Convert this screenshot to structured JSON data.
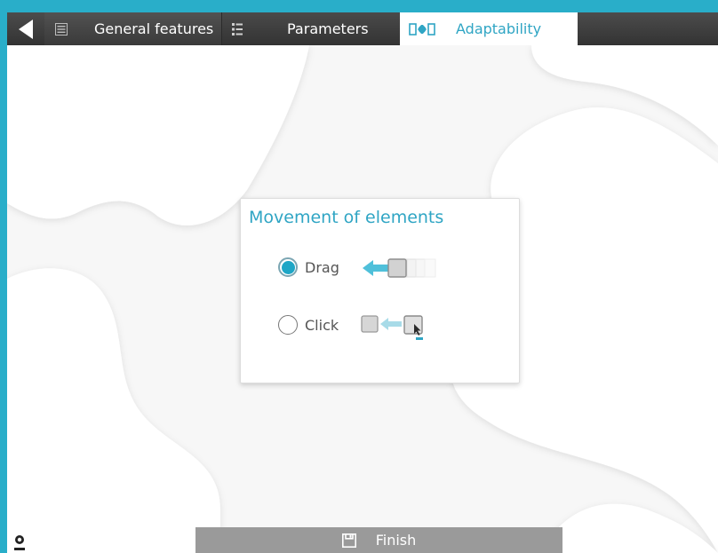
{
  "tabs": {
    "general_label": "General features",
    "parameters_label": "Parameters",
    "adaptability_label": "Adaptability"
  },
  "dialog": {
    "title": "Movement of elements",
    "options": [
      {
        "label": "Drag",
        "selected": true
      },
      {
        "label": "Click",
        "selected": false
      }
    ]
  },
  "footer": {
    "finish_label": "Finish"
  },
  "icons": {
    "back": "back-arrow-icon",
    "general": "list-panel-icon",
    "parameters": "list-bullets-icon",
    "adaptability": "adapt-icon",
    "finish": "save-icon",
    "logo": "brand-logo"
  },
  "colors": {
    "frame": "#29aec9",
    "accent": "#2fa5c4",
    "radio_fill": "#1fa6c6",
    "tabbar": "#3a3a3a",
    "finish_bar": "#9a9a9a"
  }
}
